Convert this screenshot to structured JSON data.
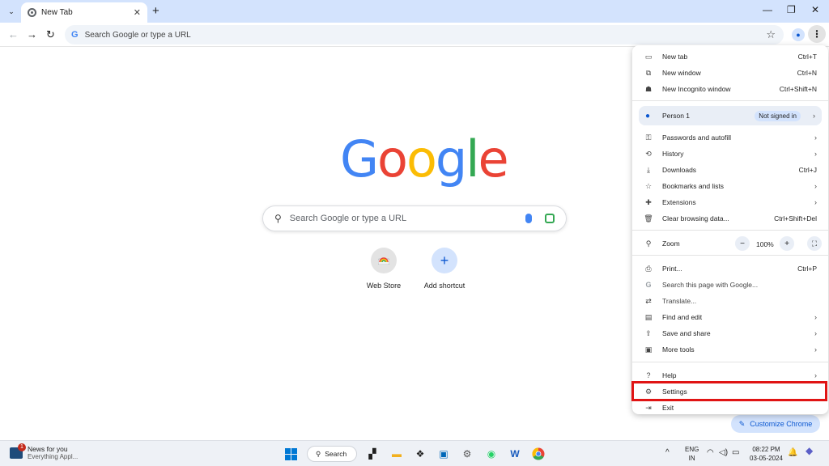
{
  "browser": {
    "tab": {
      "title": "New Tab"
    },
    "omnibox": {
      "placeholder": "Search Google or type a URL"
    }
  },
  "newtab": {
    "logo": [
      "G",
      "o",
      "o",
      "g",
      "l",
      "e"
    ],
    "search_placeholder": "Search Google or type a URL",
    "shortcuts": [
      {
        "label": "Web Store"
      },
      {
        "label": "Add shortcut"
      }
    ],
    "customize_label": "Customize Chrome"
  },
  "menu": {
    "new_tab": {
      "label": "New tab",
      "shortcut": "Ctrl+T"
    },
    "new_window": {
      "label": "New window",
      "shortcut": "Ctrl+N"
    },
    "new_incognito": {
      "label": "New Incognito window",
      "shortcut": "Ctrl+Shift+N"
    },
    "person": {
      "label": "Person 1",
      "badge": "Not signed in"
    },
    "passwords": {
      "label": "Passwords and autofill"
    },
    "history": {
      "label": "History"
    },
    "downloads": {
      "label": "Downloads",
      "shortcut": "Ctrl+J"
    },
    "bookmarks": {
      "label": "Bookmarks and lists"
    },
    "extensions": {
      "label": "Extensions"
    },
    "clear_data": {
      "label": "Clear browsing data...",
      "shortcut": "Ctrl+Shift+Del"
    },
    "zoom": {
      "label": "Zoom",
      "value": "100%"
    },
    "print": {
      "label": "Print...",
      "shortcut": "Ctrl+P"
    },
    "search_page": {
      "label": "Search this page with Google..."
    },
    "translate": {
      "label": "Translate..."
    },
    "find_edit": {
      "label": "Find and edit"
    },
    "save_share": {
      "label": "Save and share"
    },
    "more_tools": {
      "label": "More tools"
    },
    "help": {
      "label": "Help"
    },
    "settings": {
      "label": "Settings"
    },
    "exit": {
      "label": "Exit"
    }
  },
  "taskbar": {
    "news": {
      "title": "News for you",
      "subtitle": "Everything Appl...",
      "badge": "1"
    },
    "search_label": "Search",
    "lang": {
      "line1": "ENG",
      "line2": "IN"
    },
    "clock": {
      "time": "08:22 PM",
      "date": "03-05-2024"
    }
  },
  "colors": {
    "highlight": "#e01414",
    "accent": "#0b57d0"
  }
}
